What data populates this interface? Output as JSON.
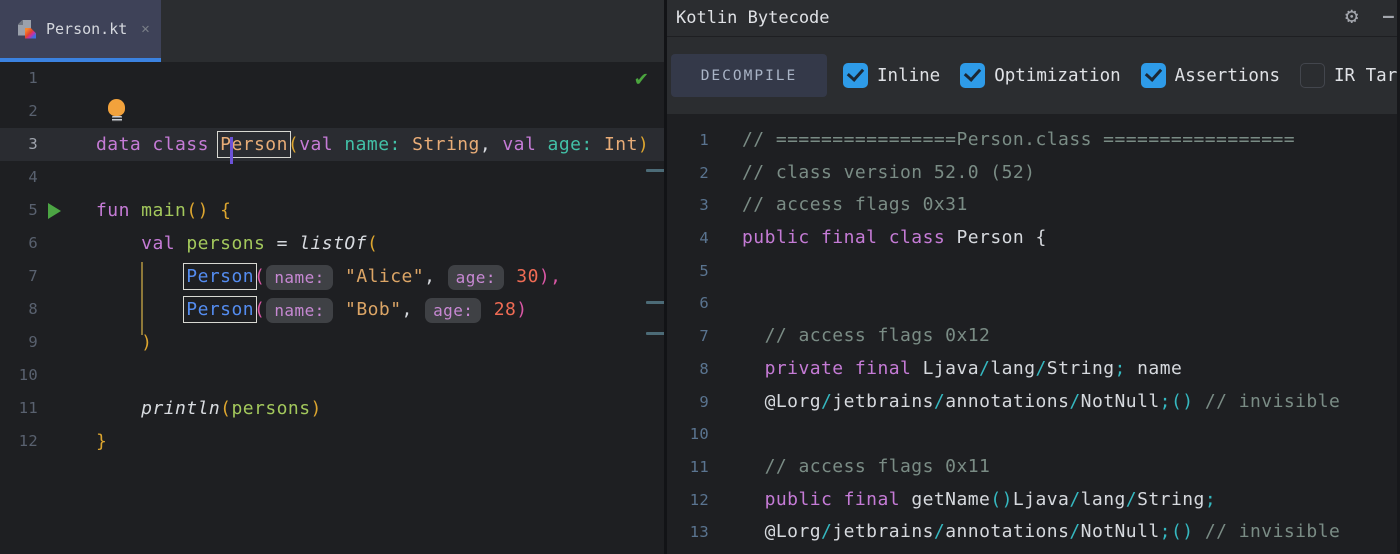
{
  "colors": {
    "bg_editor": "#1E1F22",
    "bg_chrome": "#2B2D30",
    "bg_tab": "#3E4258",
    "bg_caretrow": "#2A2C31",
    "accent_tab_underline": "#3B82E0",
    "checkbox_blue": "#2E9BE8",
    "keyword_purple": "#C57BD6",
    "class_peach": "#E8AC77",
    "param_mint": "#42C1A7",
    "string_tan": "#DCA566",
    "number_coral": "#EF6B54",
    "function_green": "#A3C85C",
    "call_italic_white": "#D8DBE0",
    "paren_gold": "#DCA52F",
    "paren_pink": "#D957A5",
    "plain_text": "#D6D9DE",
    "comment_gray_green": "#7A8C85",
    "punct_cyan": "#35B8C0",
    "usage_blue": "#548CF0",
    "hint_chip_purple": "#C788D3",
    "run_arrow_green": "#4CA544",
    "inspection_check_green": "#4BA53E",
    "lightbulb_orange": "#F2A23C"
  },
  "left_editor": {
    "tab": {
      "label": "Person.kt",
      "icon": "kotlin-file-icon",
      "close_glyph": "✕"
    },
    "inspection_check_glyph": "✔",
    "lines": [
      {
        "num": "1",
        "tokens": []
      },
      {
        "num": "2",
        "marker": "lightbulb",
        "tokens": []
      },
      {
        "num": "3",
        "active": true,
        "tokens": [
          {
            "t": "data class ",
            "c": "kw"
          },
          {
            "t": "Person",
            "c": "cls",
            "box": true,
            "caret": true
          },
          {
            "t": "(",
            "c": "p1"
          },
          {
            "t": "val ",
            "c": "kw"
          },
          {
            "t": "name:",
            "c": "param"
          },
          {
            "t": " ",
            "c": "txt"
          },
          {
            "t": "String",
            "c": "cls"
          },
          {
            "t": ", ",
            "c": "txt"
          },
          {
            "t": "val ",
            "c": "kw"
          },
          {
            "t": "age:",
            "c": "param"
          },
          {
            "t": " ",
            "c": "txt"
          },
          {
            "t": "Int",
            "c": "cls"
          },
          {
            "t": ")",
            "c": "p1"
          }
        ]
      },
      {
        "num": "4",
        "tokens": []
      },
      {
        "num": "5",
        "gutterIcon": "run-arrow",
        "tokens": [
          {
            "t": "fun ",
            "c": "kw"
          },
          {
            "t": "main",
            "c": "fn"
          },
          {
            "t": "() {",
            "c": "p1"
          }
        ]
      },
      {
        "num": "6",
        "tokens": [
          {
            "t": "    ",
            "c": "txt"
          },
          {
            "t": "val ",
            "c": "kw"
          },
          {
            "t": "persons",
            "c": "fn"
          },
          {
            "t": " = ",
            "c": "txt"
          },
          {
            "t": "listOf",
            "c": "call"
          },
          {
            "t": "(",
            "c": "p1"
          }
        ]
      },
      {
        "num": "7",
        "tokens": [
          {
            "t": "        ",
            "c": "txt"
          },
          {
            "t": "Person",
            "c": "blue",
            "box": true
          },
          {
            "t": "(",
            "c": "p2"
          },
          {
            "t": "name:",
            "chip": true
          },
          {
            "t": " ",
            "c": "txt"
          },
          {
            "t": "\"Alice\"",
            "c": "str"
          },
          {
            "t": ", ",
            "c": "txt"
          },
          {
            "t": "age:",
            "chip": true
          },
          {
            "t": " ",
            "c": "txt"
          },
          {
            "t": "30",
            "c": "num"
          },
          {
            "t": "),",
            "c": "p2"
          }
        ]
      },
      {
        "num": "8",
        "tokens": [
          {
            "t": "        ",
            "c": "txt"
          },
          {
            "t": "Person",
            "c": "blue",
            "box": true
          },
          {
            "t": "(",
            "c": "p2"
          },
          {
            "t": "name:",
            "chip": true
          },
          {
            "t": " ",
            "c": "txt"
          },
          {
            "t": "\"Bob\"",
            "c": "str"
          },
          {
            "t": ", ",
            "c": "txt"
          },
          {
            "t": "age:",
            "chip": true
          },
          {
            "t": " ",
            "c": "txt"
          },
          {
            "t": "28",
            "c": "num"
          },
          {
            "t": ")",
            "c": "p2"
          }
        ]
      },
      {
        "num": "9",
        "tokens": [
          {
            "t": "    ",
            "c": "txt"
          },
          {
            "t": ")",
            "c": "p1"
          }
        ]
      },
      {
        "num": "10",
        "tokens": []
      },
      {
        "num": "11",
        "tokens": [
          {
            "t": "    ",
            "c": "txt"
          },
          {
            "t": "println",
            "c": "call"
          },
          {
            "t": "(",
            "c": "p1"
          },
          {
            "t": "persons",
            "c": "fn"
          },
          {
            "t": ")",
            "c": "p1"
          }
        ]
      },
      {
        "num": "12",
        "tokens": [
          {
            "t": "}",
            "c": "p1"
          }
        ]
      }
    ]
  },
  "bytecode_panel": {
    "title": "Kotlin Bytecode",
    "gear_glyph": "⚙",
    "hide_glyph": "—",
    "toolbar": {
      "decompile_label": "DECOMPILE",
      "checkboxes": [
        {
          "label": "Inline",
          "checked": true
        },
        {
          "label": "Optimization",
          "checked": true
        },
        {
          "label": "Assertions",
          "checked": true
        },
        {
          "label": "IR Target",
          "checked": false
        }
      ]
    },
    "lines": [
      {
        "num": "1",
        "tokens": [
          {
            "t": "// ================Person.class =================",
            "c": "cmt"
          }
        ]
      },
      {
        "num": "2",
        "tokens": [
          {
            "t": "// class version 52.0 (52)",
            "c": "cmt"
          }
        ]
      },
      {
        "num": "3",
        "tokens": [
          {
            "t": "// access flags 0x31",
            "c": "cmt"
          }
        ]
      },
      {
        "num": "4",
        "tokens": [
          {
            "t": "public final class ",
            "c": "kw"
          },
          {
            "t": "Person {",
            "c": "txt"
          }
        ]
      },
      {
        "num": "5",
        "tokens": []
      },
      {
        "num": "6",
        "tokens": []
      },
      {
        "num": "7",
        "tokens": [
          {
            "t": "  ",
            "c": "txt"
          },
          {
            "t": "// access flags 0x12",
            "c": "cmt"
          }
        ]
      },
      {
        "num": "8",
        "tokens": [
          {
            "t": "  ",
            "c": "txt"
          },
          {
            "t": "private final ",
            "c": "kw"
          },
          {
            "t": "Ljava",
            "c": "txt"
          },
          {
            "t": "/",
            "c": "cyan"
          },
          {
            "t": "lang",
            "c": "txt"
          },
          {
            "t": "/",
            "c": "cyan"
          },
          {
            "t": "String",
            "c": "txt"
          },
          {
            "t": ";",
            "c": "cyan"
          },
          {
            "t": " name",
            "c": "txt"
          }
        ]
      },
      {
        "num": "9",
        "tokens": [
          {
            "t": "  ",
            "c": "txt"
          },
          {
            "t": "@Lorg",
            "c": "txt"
          },
          {
            "t": "/",
            "c": "cyan"
          },
          {
            "t": "jetbrains",
            "c": "txt"
          },
          {
            "t": "/",
            "c": "cyan"
          },
          {
            "t": "annotations",
            "c": "txt"
          },
          {
            "t": "/",
            "c": "cyan"
          },
          {
            "t": "NotNull",
            "c": "txt"
          },
          {
            "t": ";()",
            "c": "cyan"
          },
          {
            "t": " ",
            "c": "txt"
          },
          {
            "t": "// invisible",
            "c": "cmt"
          }
        ]
      },
      {
        "num": "10",
        "tokens": []
      },
      {
        "num": "11",
        "tokens": [
          {
            "t": "  ",
            "c": "txt"
          },
          {
            "t": "// access flags 0x11",
            "c": "cmt"
          }
        ]
      },
      {
        "num": "12",
        "tokens": [
          {
            "t": "  ",
            "c": "txt"
          },
          {
            "t": "public final ",
            "c": "kw"
          },
          {
            "t": "getName",
            "c": "txt"
          },
          {
            "t": "()",
            "c": "cyan"
          },
          {
            "t": "Ljava",
            "c": "txt"
          },
          {
            "t": "/",
            "c": "cyan"
          },
          {
            "t": "lang",
            "c": "txt"
          },
          {
            "t": "/",
            "c": "cyan"
          },
          {
            "t": "String",
            "c": "txt"
          },
          {
            "t": ";",
            "c": "cyan"
          }
        ]
      },
      {
        "num": "13",
        "tokens": [
          {
            "t": "  ",
            "c": "txt"
          },
          {
            "t": "@Lorg",
            "c": "txt"
          },
          {
            "t": "/",
            "c": "cyan"
          },
          {
            "t": "jetbrains",
            "c": "txt"
          },
          {
            "t": "/",
            "c": "cyan"
          },
          {
            "t": "annotations",
            "c": "txt"
          },
          {
            "t": "/",
            "c": "cyan"
          },
          {
            "t": "NotNull",
            "c": "txt"
          },
          {
            "t": ";()",
            "c": "cyan"
          },
          {
            "t": " ",
            "c": "txt"
          },
          {
            "t": "// invisible",
            "c": "cmt"
          }
        ]
      }
    ]
  }
}
